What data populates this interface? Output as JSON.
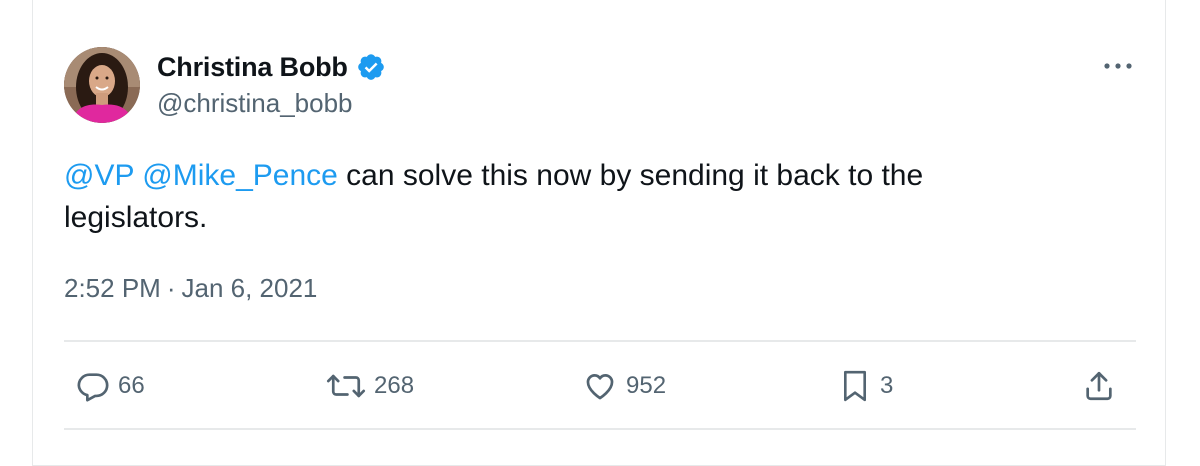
{
  "author": {
    "display_name": "Christina Bobb",
    "handle": "@christina_bobb",
    "verified": true,
    "avatar_icon": "profile-photo"
  },
  "tweet": {
    "mentions": [
      "@VP",
      "@Mike_Pence"
    ],
    "body_text": "can solve this now by sending it back to the legislators.",
    "time": "2:52 PM",
    "separator": "·",
    "date": "Jan 6, 2021"
  },
  "actions": {
    "replies": "66",
    "retweets": "268",
    "likes": "952",
    "bookmarks": "3"
  },
  "icons": {
    "more": "more-horizontal-icon",
    "reply": "reply-icon",
    "retweet": "retweet-icon",
    "like": "heart-icon",
    "bookmark": "bookmark-icon",
    "share": "share-icon"
  },
  "colors": {
    "accent": "#1d9bf0",
    "text": "#0f1419",
    "secondary": "#536471",
    "border": "#e7e9ea"
  }
}
